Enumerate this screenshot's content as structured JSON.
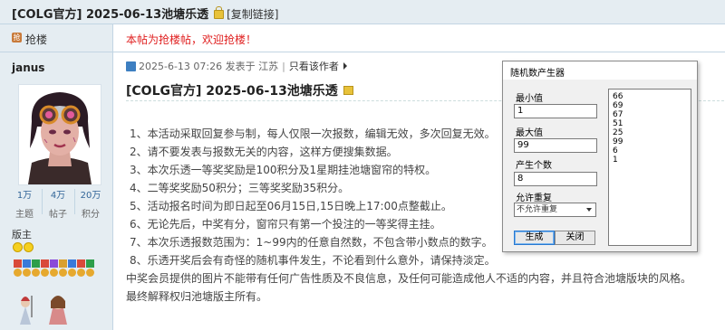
{
  "thread": {
    "title": "[COLG官方] 2025-06-13池塘乐透",
    "copy_link": "[复制链接]"
  },
  "sidebar": {
    "grab_label": "抢楼",
    "username": "janus",
    "stats": [
      {
        "value": "1万",
        "label": "主题"
      },
      {
        "value": "4万",
        "label": "帖子"
      },
      {
        "value": "20万",
        "label": "积分"
      }
    ],
    "role": "版主"
  },
  "post": {
    "notice": "本帖为抢楼帖，欢迎抢楼！",
    "date": "2025-6-13 07:26",
    "location": "发表于 江苏",
    "only_author": "只看该作者",
    "title": "[COLG官方] 2025-06-13池塘乐透",
    "lines": [
      "1、本活动采取回复参与制，每人仅限一次报数，编辑无效，多次回复无效。",
      "2、请不要发表与报数无关的内容，这样方便搜集数据。",
      "3、本次乐透一等奖奖励是100积分及1星期挂池塘窗帘的特权。",
      "4、二等奖奖励50积分；三等奖奖励35积分。",
      "5、活动报名时间为即日起至06月15日,15日晚上17:00点整截止。",
      "6、无论先后，中奖有分，窗帘只有第一个投注的一等奖得主挂。",
      "7、本次乐透报数范围为：1~99内的任意自然数，不包含带小数点的数字。",
      "8、乐透开奖后会有奇怪的随机事件发生，不论看到什么意外，请保持淡定。",
      "中奖会员提供的图片不能带有任何广告性质及不良信息，及任何可能造成他人不适的内容，并且符合池塘版块的风格。",
      "最终解释权归池塘版主所有。"
    ]
  },
  "dialog": {
    "title": "随机数产生器",
    "min_label": "最小值",
    "min_value": "1",
    "max_label": "最大值",
    "max_value": "99",
    "count_label": "产生个数",
    "count_value": "8",
    "repeat_label": "允许重复",
    "repeat_value": "不允许重复",
    "generate_label": "生成",
    "close_label": "关闭",
    "results": [
      "66",
      "69",
      "67",
      "51",
      "25",
      "99",
      "6",
      "1"
    ]
  },
  "colors": {
    "header_bg": "#e5edf2",
    "border": "#c2d5e3",
    "notice": "#e02020"
  }
}
